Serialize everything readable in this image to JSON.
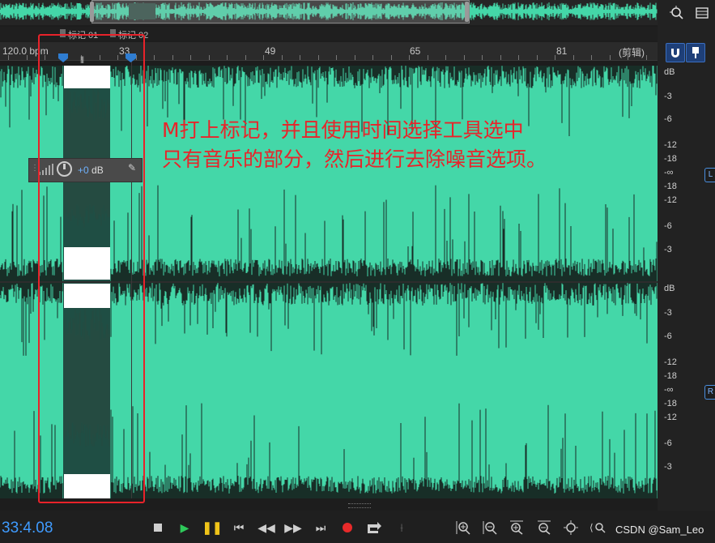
{
  "overview": {
    "label": "overview-waveform"
  },
  "markers": [
    {
      "label": "标记 01"
    },
    {
      "label": "标记 02"
    }
  ],
  "ruler": {
    "labels": [
      "120.0 bpm",
      "33",
      "49",
      "65",
      "81",
      "(剪辑)"
    ]
  },
  "db_scale": {
    "channel1": [
      "dB",
      "-3",
      "-6",
      "-12",
      "-18",
      "-∞",
      "-18",
      "-12",
      "-6",
      "-3"
    ],
    "channel2": [
      "dB",
      "-3",
      "-6",
      "-12",
      "-18",
      "-∞",
      "-18",
      "-12",
      "-6",
      "-3"
    ],
    "channel1_badge": "L",
    "channel2_badge": "R"
  },
  "hud": {
    "value": "+0",
    "unit": "dB"
  },
  "annotation": {
    "line1": "M打上标记，并且使用时间选择工具选中",
    "line2": "只有音乐的部分，然后进行去除噪音选项。"
  },
  "transport": {
    "time": "33:4.08"
  },
  "watermark": "CSDN @Sam_Leo",
  "colors": {
    "waveform": "#44d7a8",
    "accent": "#3f9bff",
    "annotation": "#e8242a",
    "play": "#2ec95a",
    "pause": "#f0c419",
    "record": "#e82a2a"
  }
}
